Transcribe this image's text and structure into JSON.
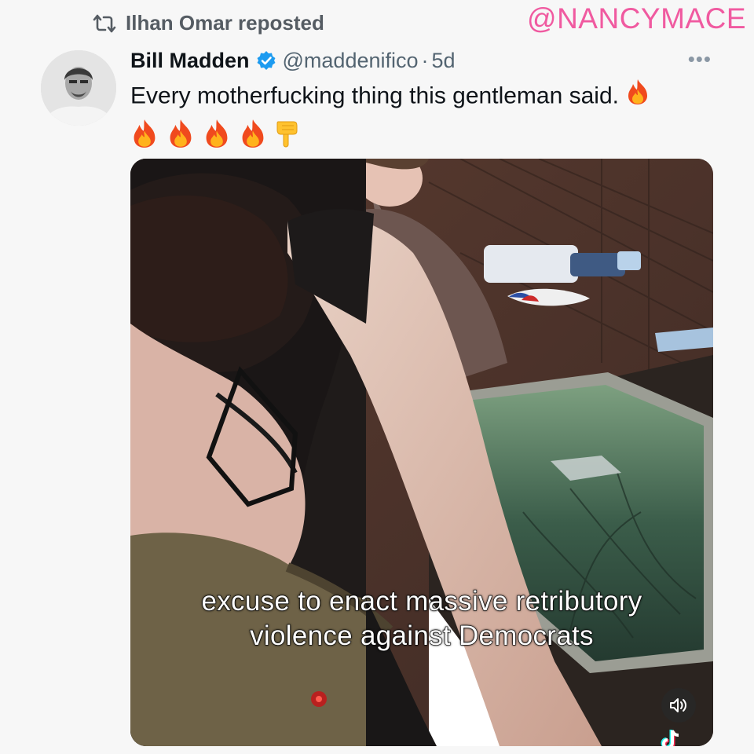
{
  "watermark": "@NANCYMACE",
  "repost": {
    "label": "Ilhan Omar reposted",
    "icon": "repost-icon"
  },
  "tweet": {
    "author_name": "Bill Madden",
    "verified_icon": "verified-badge-icon",
    "handle": "@maddenifico",
    "separator": "·",
    "age": "5d",
    "more_icon": "more-dots-icon",
    "text": "Every motherfucking thing this gentleman said.",
    "emojis_inline": [
      "fire-emoji"
    ],
    "emojis_row": [
      "fire-emoji",
      "fire-emoji",
      "fire-emoji",
      "fire-emoji",
      "pointing-down-emoji"
    ]
  },
  "video": {
    "caption_line1": "excuse to enact massive retributory",
    "caption_line2": "violence against Democrats",
    "volume_icon": "volume-icon",
    "brand_icon": "tiktok-logo-icon"
  },
  "colors": {
    "watermark": "#f05aa0",
    "verified": "#1d9bf0",
    "muted_text": "#536471",
    "primary_text": "#0f1419"
  }
}
